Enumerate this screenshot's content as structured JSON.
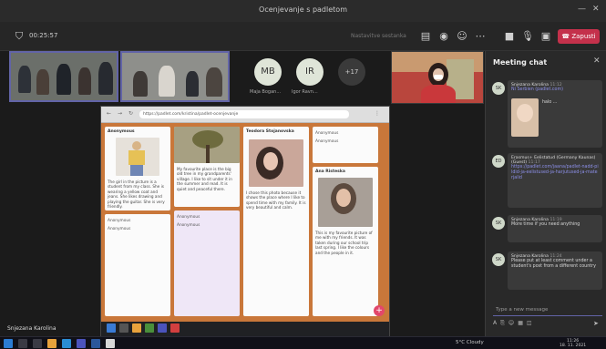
{
  "window": {
    "title": "Ocenjevanje s padletom"
  },
  "toolbar": {
    "timer": "00:25:57",
    "status_text": "Nastavitve sestanka",
    "leave_label": "Zapusti"
  },
  "participants": [
    {
      "initials": "MB",
      "name": "Maja Bogan..."
    },
    {
      "initials": "IR",
      "name": "Igor Ravn..."
    }
  ],
  "overflow_count": "+17",
  "shared_screen": {
    "url": "https://padlet.com/kristina/padlet-ocenjevanje",
    "cards": {
      "anonymous_1": "Anonymous",
      "author_a": "Teodora Stojanovska",
      "author_b": "Ana Risteska",
      "ana_text": "This is my favourite picture of me with my friends. It was taken during our school trip last spring. I like the colours and the people in it.",
      "tree_text": "My favourite place is the big old tree in my grandparents' village. I like to sit under it in the summer and read. It is quiet and peaceful there.",
      "girl_text": "The girl in the picture is a student from my class. She is wearing a yellow coat and jeans. She likes drawing and playing the guitar. She is very friendly.",
      "teo_text": "I chose this photo because it shows the place where I like to spend time with my family. It is very beautiful and calm.",
      "comment_1": "Anonymous",
      "comment_2": "Anonymous",
      "comment_3": "Anonymous",
      "comment_4": "Anonymous"
    }
  },
  "presenter": "Snjezana Karolina",
  "chat": {
    "title": "Meeting chat",
    "messages": [
      {
        "initials": "SK",
        "sender": "Snjezana Karolina",
        "time": "11:12",
        "body": "Ni Serbien (padlet.com)",
        "image_caption": "halo ..."
      },
      {
        "initials": "ED",
        "sender": "Erasmus+ Eelistatud (Germany Kaunas) (Guest)",
        "time": "11:17",
        "link": "https://padlet.com/jaana/padlet-nadd-pildid-ja-eelistused-ja-harjutused-ja-materjalid"
      },
      {
        "initials": "SK",
        "sender": "Snjezana Karolina",
        "time": "11:19",
        "body": "More time if you need anything"
      },
      {
        "initials": "SK",
        "sender": "Snjezana Karolina",
        "time": "11:24",
        "body": "Please put at least comment under a student's post from a different country"
      }
    ],
    "compose_placeholder": "Type a new message"
  },
  "taskbar": {
    "weather": "5°C Cloudy",
    "time": "11:26",
    "date": "18. 11. 2021"
  },
  "colors": {
    "accent": "#6264a7",
    "leave": "#c4314b",
    "padlet_bg": "#c9773a"
  }
}
